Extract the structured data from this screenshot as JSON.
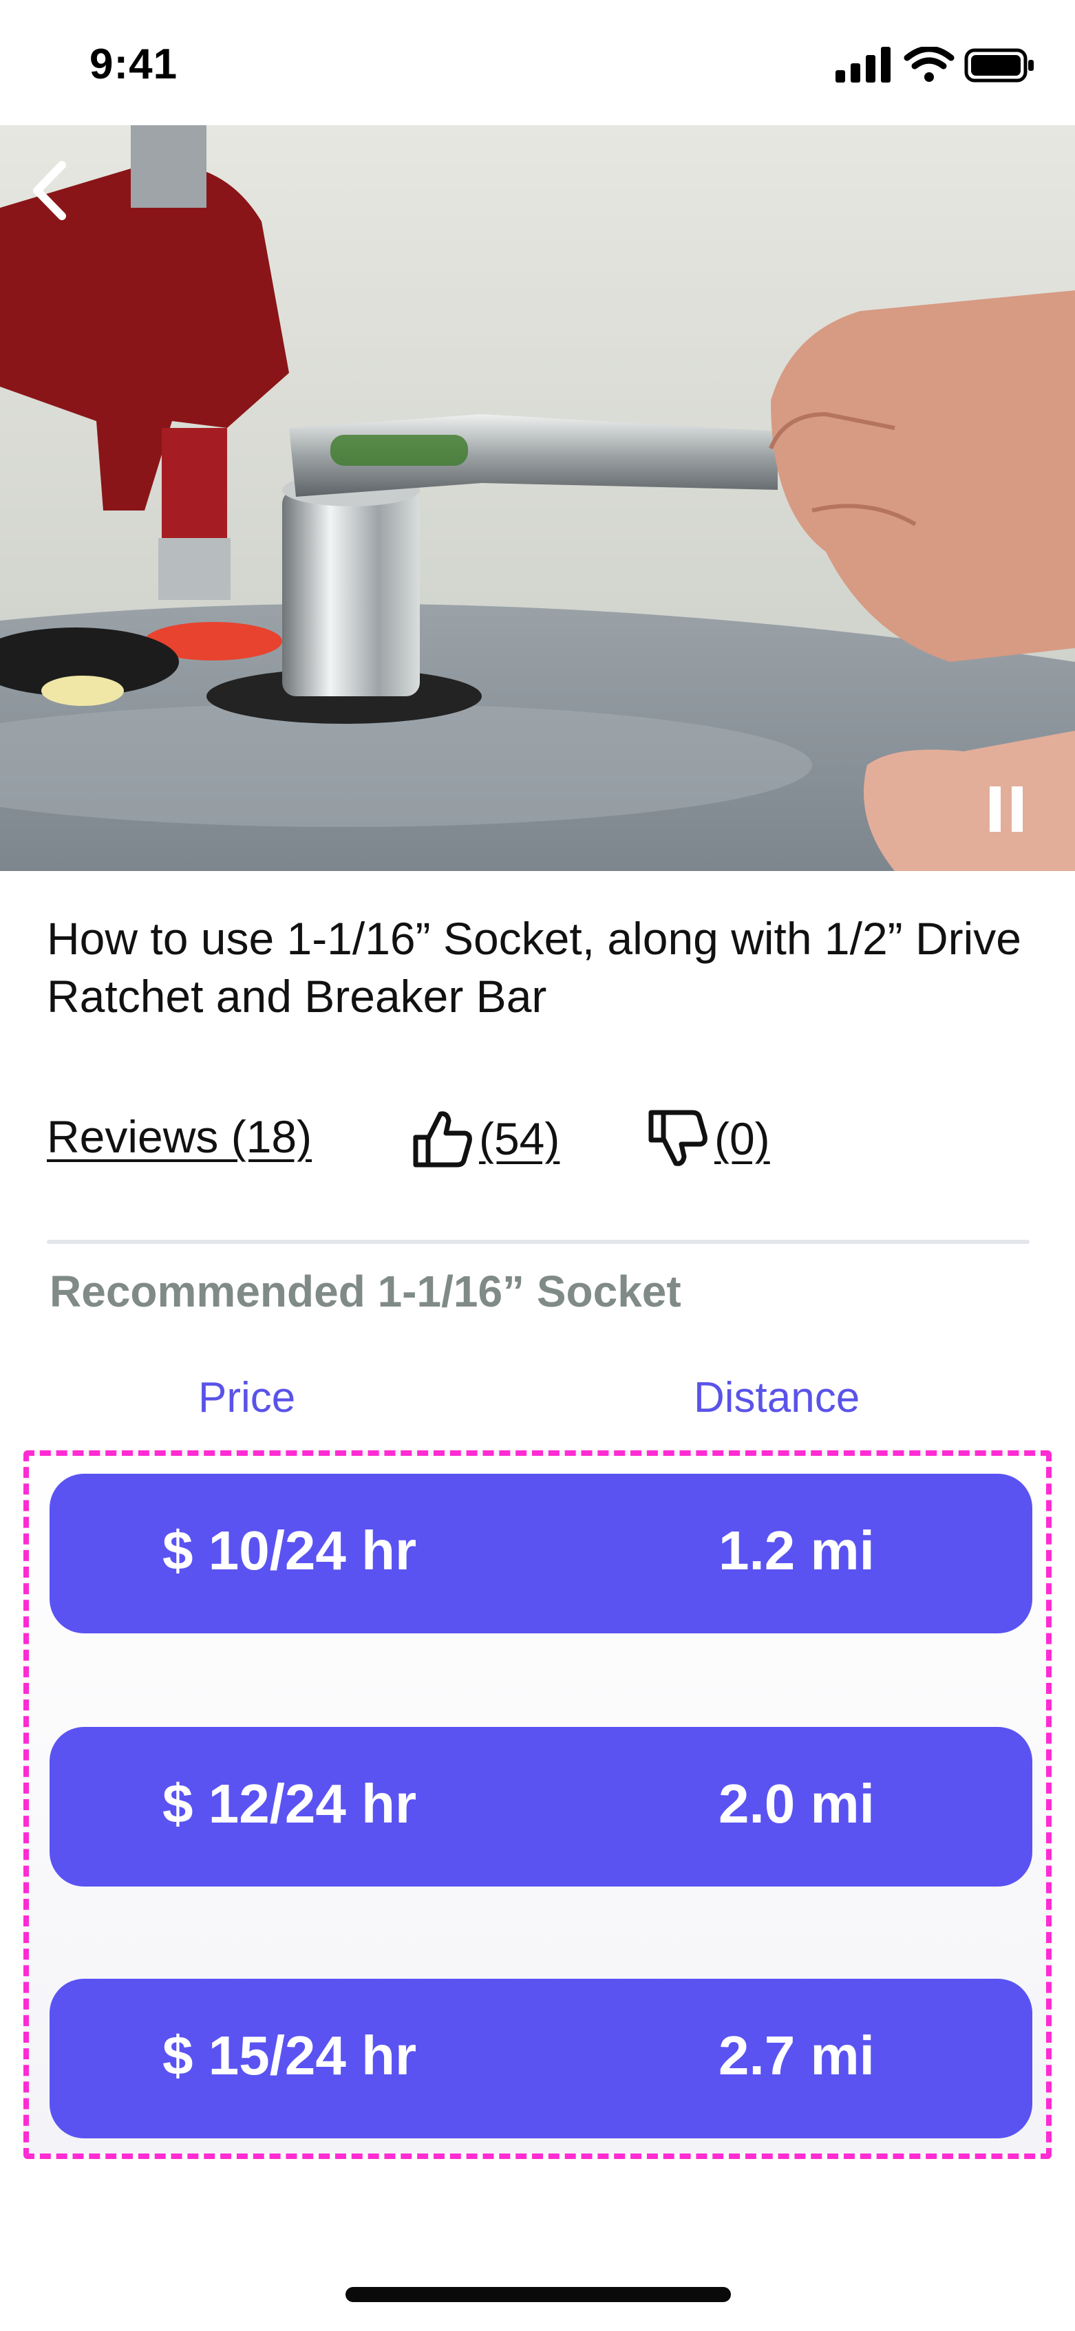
{
  "status_bar": {
    "time": "9:41",
    "icons": [
      "cellular-signal-icon",
      "wifi-icon",
      "battery-icon"
    ]
  },
  "video": {
    "controls": {
      "back_icon": "chevron-left-icon",
      "pause_icon": "pause-icon"
    }
  },
  "tool": {
    "title": "How to use 1-1/16” Socket, along with 1/2” Drive Ratchet and Breaker Bar"
  },
  "actions": {
    "reviews_label": "Reviews (18)",
    "likes_label": "(54)",
    "dislikes_label": "(0)",
    "like_icon": "thumbs-up-icon",
    "dislike_icon": "thumbs-down-icon"
  },
  "recommended": {
    "heading": "Recommended 1-1/16” Socket",
    "columns": {
      "price": "Price",
      "distance": "Distance"
    },
    "offers": [
      {
        "price": "$ 10/24 hr",
        "distance": "1.2 mi"
      },
      {
        "price": "$ 12/24 hr",
        "distance": "2.0 mi"
      },
      {
        "price": "$ 15/24 hr",
        "distance": "2.7 mi"
      }
    ]
  },
  "colors": {
    "accent": "#5a53f2",
    "column_header": "#5a53e8",
    "highlight_dashed": "#ff2bd3",
    "heading_gray": "#808a87"
  }
}
